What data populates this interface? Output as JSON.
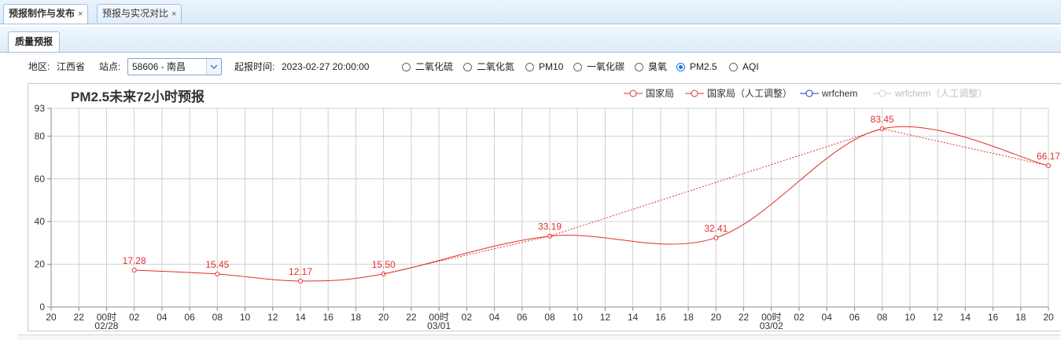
{
  "outer_tabs": [
    {
      "label": "预报制作与发布",
      "close": "×"
    },
    {
      "label": "预报与实况对比",
      "close": "×"
    }
  ],
  "inner_tab": "质量预报",
  "toolbar": {
    "region_label": "地区:",
    "region_value": "江西省",
    "station_label": "站点:",
    "station_value": "58606 - 南昌",
    "issue_time_label": "起报时间:",
    "issue_time_value": "2023-02-27 20:00:00",
    "pollutants": [
      "二氧化硫",
      "二氧化氮",
      "PM10",
      "一氧化碳",
      "臭氧",
      "PM2.5",
      "AQI"
    ],
    "selected_pollutant": "PM2.5"
  },
  "colors": {
    "accent": "#1a73e8",
    "series_red": "#e0302b",
    "series_blue": "#2030c0",
    "series_disabled": "#cccccc"
  },
  "chart_data": {
    "type": "line",
    "title": "PM2.5未来72小时预报",
    "legend_position": "top-right",
    "grid": true,
    "ylim": [
      0,
      93
    ],
    "yticks": [
      0,
      20,
      40,
      60,
      80,
      93
    ],
    "x_hours_ticks": [
      "20",
      "22",
      "00时",
      "02",
      "04",
      "06",
      "08",
      "10",
      "12",
      "14",
      "16",
      "18",
      "20",
      "22",
      "00时",
      "02",
      "04",
      "06",
      "08",
      "10",
      "12",
      "14",
      "16",
      "18",
      "20",
      "22",
      "00时",
      "02",
      "04",
      "06",
      "08",
      "10",
      "12",
      "14",
      "16",
      "18",
      "20"
    ],
    "x_date_labels": [
      {
        "tick_index": 2,
        "label": "02/28"
      },
      {
        "tick_index": 14,
        "label": "03/01"
      },
      {
        "tick_index": 26,
        "label": "03/02"
      }
    ],
    "xlim_hours": [
      0,
      72
    ],
    "series": [
      {
        "name": "国家局",
        "style": "solid",
        "color": "#e0302b",
        "x": [
          6,
          12,
          18,
          24,
          36,
          48,
          60,
          72
        ],
        "y": [
          17.28,
          15.45,
          12.17,
          15.5,
          33.19,
          32.41,
          83.45,
          66.17
        ],
        "labels": [
          "17.28",
          "15.45",
          "12.17",
          "15.50",
          "33.19",
          "32.41",
          "83.45",
          "66.17"
        ]
      },
      {
        "name": "国家局（人工调整）",
        "style": "dotted",
        "color": "#e0302b",
        "x": [
          24,
          36,
          60,
          72
        ],
        "y": [
          15.5,
          33.19,
          83.45,
          66.17
        ]
      },
      {
        "name": "wrfchem",
        "style": "solid",
        "color": "#2030c0",
        "x": [],
        "y": []
      },
      {
        "name": "wrfchem（人工调整）",
        "style": "solid",
        "color": "#cccccc",
        "disabled": true,
        "x": [],
        "y": []
      }
    ]
  }
}
